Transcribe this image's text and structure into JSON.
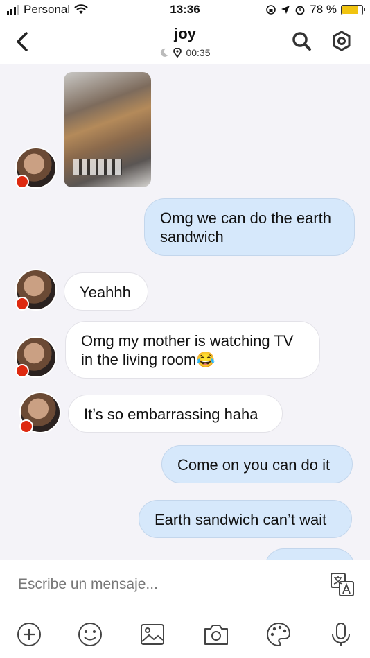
{
  "status_bar": {
    "carrier": "Personal",
    "time": "13:36",
    "battery": "78 %"
  },
  "header": {
    "contact_name": "joy",
    "last_seen": "00:35"
  },
  "messages": [
    {
      "from": "them",
      "type": "image"
    },
    {
      "from": "me",
      "text": "Omg we can do the earth sandwich"
    },
    {
      "from": "them",
      "text": "Yeahhh"
    },
    {
      "from": "them",
      "text": "Omg my mother is watching TV in the living room😂"
    },
    {
      "from": "them",
      "text": "It’s so embarrassing haha"
    },
    {
      "from": "me",
      "text": "Come on you can do it"
    },
    {
      "from": "me",
      "text": "Earth sandwich can’t wait"
    }
  ],
  "composer": {
    "placeholder": "Escribe un mensaje..."
  },
  "icons": [
    "back-icon",
    "search-icon",
    "settings-icon",
    "translate-icon",
    "add-icon",
    "emoji-icon",
    "gallery-icon",
    "camera-icon",
    "palette-icon",
    "microphone-icon"
  ],
  "colors": {
    "outgoing_bubble": "#d6e8fb",
    "incoming_bubble": "#ffffff",
    "background": "#f4f3f8"
  }
}
